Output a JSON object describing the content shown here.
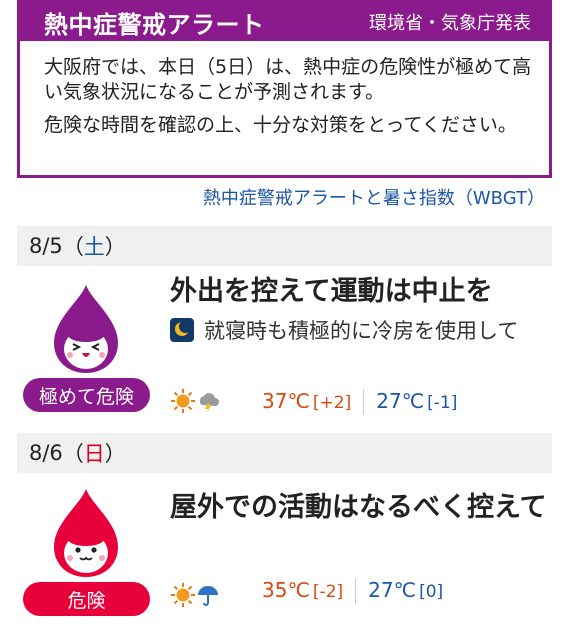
{
  "alert": {
    "title": "熱中症警戒アラート",
    "source": "環境省・気象庁発表",
    "body_1": "大阪府では、本日（5日）は、熱中症の危険性が極めて高い気象状況になることが予測されます。",
    "body_2": "危険な時間を確認の上、十分な対策をとってください。"
  },
  "wbgt_link": "熱中症警戒アラートと暑さ指数（WBGT）",
  "days": [
    {
      "date": "8/5",
      "weekday_open": "（",
      "weekday": "土",
      "weekday_close": "）",
      "level": "極めて危険",
      "level_color": "#8b1a8c",
      "headline": "外出を控えて運動は中止を",
      "night_note": "就寝時も積極的に冷房を使用して",
      "weather_icons": [
        "sun-icon",
        "cloud-thunder-icon"
      ],
      "max_temp": "37℃",
      "max_diff": "[+2]",
      "min_temp": "27℃",
      "min_diff": "[-1]"
    },
    {
      "date": "8/6",
      "weekday_open": "（",
      "weekday": "日",
      "weekday_close": "）",
      "level": "危険",
      "level_color": "#e8003a",
      "headline": "屋外での活動はなるべく控えて",
      "weather_icons": [
        "sun-icon",
        "umbrella-icon"
      ],
      "max_temp": "35℃",
      "max_diff": "[-2]",
      "min_temp": "27℃",
      "min_diff": "[0]"
    }
  ],
  "colors": {
    "extreme": "#8b1a8c",
    "danger": "#e8003a",
    "link": "#1a56a8",
    "max": "#d9480f",
    "min": "#1a56a8"
  }
}
